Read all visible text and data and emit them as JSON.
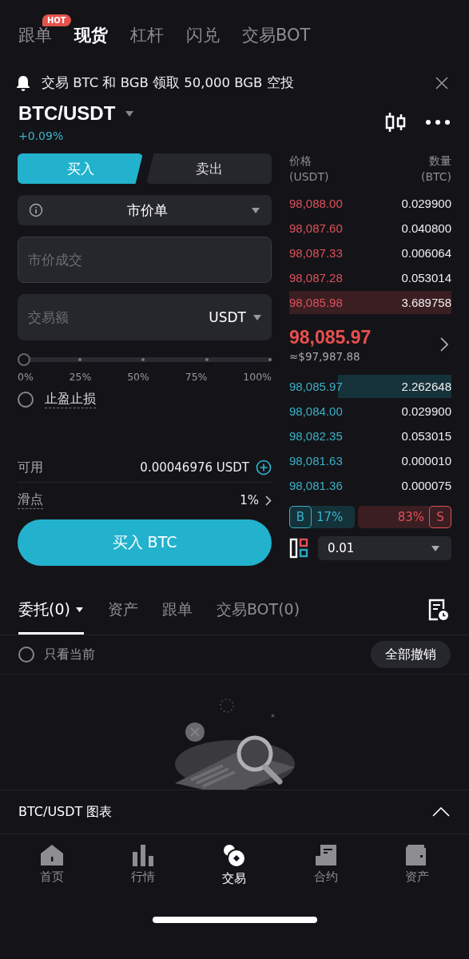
{
  "top_tabs": [
    {
      "label": "跟单",
      "selected": false,
      "badge": "HOT"
    },
    {
      "label": "现货",
      "selected": true
    },
    {
      "label": "杠杆",
      "selected": false
    },
    {
      "label": "闪兑",
      "selected": false
    },
    {
      "label": "交易BOT",
      "selected": false
    }
  ],
  "notice": {
    "text": "交易 BTC 和 BGB 领取 50,000 BGB 空投"
  },
  "pair": {
    "symbol": "BTC/USDT",
    "change": "+0.09%"
  },
  "side_tabs": [
    {
      "label": "买入",
      "selected": true
    },
    {
      "label": "卖出",
      "selected": false
    }
  ],
  "order_type": "市价单",
  "price_field": {
    "placeholder": "市价成交"
  },
  "amount_field": {
    "placeholder": "交易额",
    "unit": "USDT"
  },
  "slider": {
    "level": 0,
    "marks": [
      "0%",
      "25%",
      "50%",
      "75%",
      "100%"
    ]
  },
  "tpsl": {
    "label": "止盈止损",
    "checked": false
  },
  "available": {
    "label": "可用",
    "value": "0.00046976 USDT"
  },
  "slippage": {
    "label": "滑点",
    "value": "1%"
  },
  "submit": "买入 BTC",
  "orderbook": {
    "headers": [
      {
        "label": "价格",
        "unit": "(USDT)"
      },
      {
        "label": "数量",
        "unit": "(BTC)"
      }
    ],
    "asks": [
      {
        "price": "98,088.00",
        "qty": "0.029900"
      },
      {
        "price": "98,087.60",
        "qty": "0.040800"
      },
      {
        "price": "98,087.33",
        "qty": "0.006064"
      },
      {
        "price": "98,087.28",
        "qty": "0.053014"
      },
      {
        "price": "98,085.98",
        "qty": "3.689758"
      }
    ],
    "last_price": "98,085.97",
    "last_usd": "≈$97,987.88",
    "bids": [
      {
        "price": "98,085.97",
        "qty": "2.262648"
      },
      {
        "price": "98,084.00",
        "qty": "0.029900"
      },
      {
        "price": "98,082.35",
        "qty": "0.053015"
      },
      {
        "price": "98,081.63",
        "qty": "0.000010"
      },
      {
        "price": "98,081.36",
        "qty": "0.000075"
      }
    ],
    "buy": {
      "label": "B",
      "value": "17%"
    },
    "sell": {
      "label": "S",
      "value": "83%"
    },
    "precision": "0.01"
  },
  "bottom_tabs": [
    {
      "label": "委托(0)",
      "selected": true,
      "dropdown": true
    },
    {
      "label": "资产",
      "selected": false,
      "dropdown": false
    },
    {
      "label": "跟单",
      "selected": false,
      "dropdown": false
    },
    {
      "label": "交易BOT(0)",
      "selected": false,
      "dropdown": false
    }
  ],
  "filter": {
    "label": "只看当前",
    "checked": false
  },
  "cancel_all": "全部撤销",
  "chart_bar": {
    "label": "BTC/USDT 图表",
    "expanded": false
  },
  "nav": [
    {
      "label": "首页",
      "kind": "home",
      "selected": false
    },
    {
      "label": "行情",
      "kind": "market",
      "selected": false
    },
    {
      "label": "交易",
      "kind": "trade",
      "selected": true
    },
    {
      "label": "合约",
      "kind": "futures",
      "selected": false
    },
    {
      "label": "资产",
      "kind": "assets",
      "selected": false
    }
  ]
}
